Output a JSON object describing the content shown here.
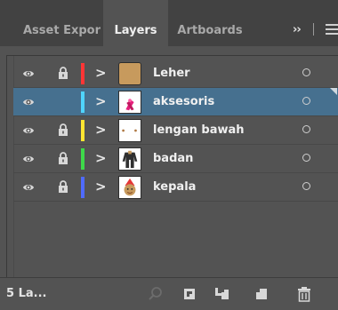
{
  "tabs": [
    {
      "label": "Asset Expor",
      "active": false
    },
    {
      "label": "Layers",
      "active": true
    },
    {
      "label": "Artboards",
      "active": false
    }
  ],
  "tab_overflow_label": "››",
  "layers": [
    {
      "name": "Leher",
      "color": "#ff3535",
      "locked": true,
      "selected": false,
      "thumb": "skin-color-swatch"
    },
    {
      "name": "aksesoris",
      "color": "#4fd5ff",
      "locked": false,
      "selected": true,
      "thumb": "pink-ribbon"
    },
    {
      "name": "lengan bawah",
      "color": "#ffe531",
      "locked": true,
      "selected": false,
      "thumb": "white-with-dots"
    },
    {
      "name": "badan",
      "color": "#3ed94a",
      "locked": true,
      "selected": false,
      "thumb": "dark-body-figure"
    },
    {
      "name": "kepala",
      "color": "#4f6bff",
      "locked": true,
      "selected": false,
      "thumb": "head-with-red-cap"
    }
  ],
  "status": {
    "layer_count": "5 La..."
  },
  "colors": {
    "panel_bg": "#535353",
    "tabbar_bg": "#424242",
    "selection": "#46708f"
  },
  "icons": [
    "visibility-eye-icon",
    "lock-icon",
    "expand-chevron-icon",
    "target-circle-icon",
    "locate-object-icon",
    "clipping-mask-icon",
    "new-sublayer-icon",
    "new-layer-icon",
    "delete-trash-icon",
    "panel-menu-icon"
  ]
}
